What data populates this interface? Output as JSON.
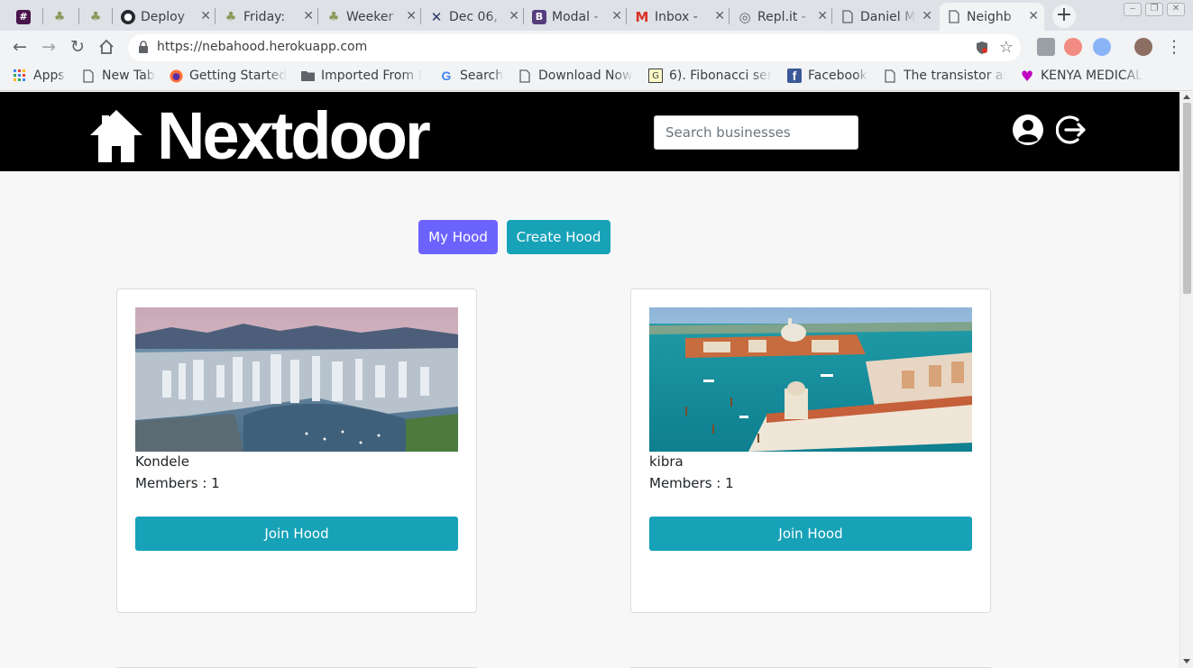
{
  "browser": {
    "tabs": [
      {
        "label": "",
        "icon": "slack-icon",
        "active": false
      },
      {
        "label": "",
        "icon": "palm-icon",
        "active": false
      },
      {
        "label": "",
        "icon": "palm-icon",
        "active": false
      },
      {
        "label": "Deploy",
        "icon": "github-icon",
        "active": false
      },
      {
        "label": "Friday:",
        "icon": "palm-icon",
        "active": false
      },
      {
        "label": "Weeker",
        "icon": "palm-icon",
        "active": false
      },
      {
        "label": "Dec 06,",
        "icon": "cross-icon",
        "active": false
      },
      {
        "label": "Modal -",
        "icon": "bootstrap-icon",
        "active": false
      },
      {
        "label": "Inbox -",
        "icon": "gmail-icon",
        "active": false
      },
      {
        "label": "Repl.it -",
        "icon": "replit-icon",
        "active": false
      },
      {
        "label": "Daniel M",
        "icon": "page-icon",
        "active": false
      },
      {
        "label": "Neighb",
        "icon": "page-icon",
        "active": true
      }
    ],
    "url": "https://nebahood.herokuapp.com",
    "bookmarks": [
      {
        "label": "Apps",
        "icon": "apps-grid-icon"
      },
      {
        "label": "New Tab",
        "icon": "page-icon"
      },
      {
        "label": "Getting Started",
        "icon": "firefox-icon"
      },
      {
        "label": "Imported From F",
        "icon": "folder-icon"
      },
      {
        "label": "Search",
        "icon": "google-icon"
      },
      {
        "label": "Download Now",
        "icon": "page-icon"
      },
      {
        "label": "6). Fibonacci seri",
        "icon": "fibonacci-icon"
      },
      {
        "label": "Facebook",
        "icon": "facebook-icon"
      },
      {
        "label": "The transistor as",
        "icon": "page-icon"
      },
      {
        "label": "KENYA MEDICAL",
        "icon": "heart-icon"
      }
    ]
  },
  "navbar": {
    "brand": "Nextdoor",
    "search_placeholder": "Search businesses",
    "profile_icon": "user-circle-icon",
    "logout_icon": "sign-out-icon"
  },
  "actions": {
    "my_hood": "My Hood",
    "create_hood": "Create Hood"
  },
  "hoods": [
    {
      "name": "Kondele",
      "members": "Members : 1",
      "join": "Join Hood",
      "image": "city-skyline-photo"
    },
    {
      "name": "kibra",
      "members": "Members : 1",
      "join": "Join Hood",
      "image": "venice-lagoon-photo"
    }
  ],
  "colors": {
    "navbar_bg": "#000000",
    "primary": "#6c63ff",
    "info": "#17a2b8",
    "page_bg": "#f7f7f7"
  }
}
